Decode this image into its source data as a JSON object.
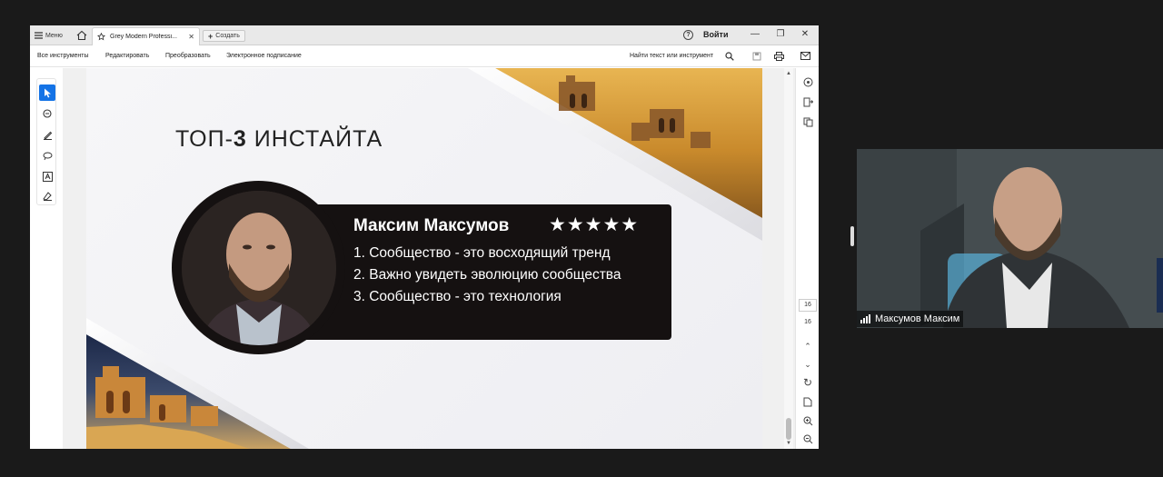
{
  "window": {
    "menu_label": "Меню",
    "tab_title": "Grey Modern Professi...",
    "new_tab_label": "Создать",
    "help_icon": "?",
    "signin_label": "Войти",
    "controls": [
      "—",
      "❐",
      "✕"
    ]
  },
  "menubar": {
    "items": [
      "Все инструменты",
      "Редактировать",
      "Преобразовать",
      "Электронное подписание"
    ],
    "find_label": "Найти текст или инструмент"
  },
  "left_tools": [
    "select-tool",
    "comment-tool",
    "highlight-tool",
    "draw-tool",
    "text-tool",
    "sign-tool"
  ],
  "slide": {
    "title_pre": "ТОП-",
    "title_num": "3",
    "title_post": " ИНСТАЙТА",
    "speaker_name": "Максим Максумов",
    "stars": "★★★★★",
    "rating": 5,
    "points": [
      "1. Сообщество - это восходящий тренд",
      "2. Важно увидеть эволюцию сообщества",
      "3. Сообщество - это технология"
    ]
  },
  "right_panel": {
    "page_current": "16",
    "page_total": "16"
  },
  "webcam": {
    "participant_name": "Максумов Максим"
  },
  "colors": {
    "accent": "#1473e6",
    "card": "#151111",
    "background": "#1a1a1a"
  }
}
